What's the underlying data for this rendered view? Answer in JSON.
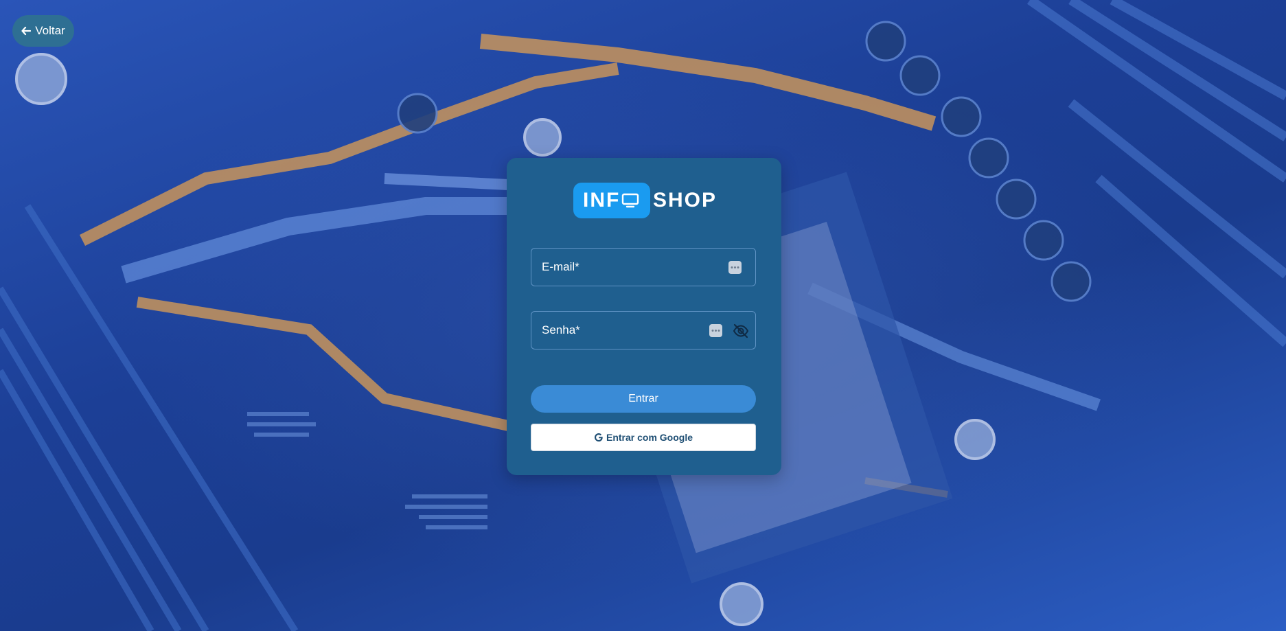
{
  "nav": {
    "back_label": "Voltar",
    "back_icon": "arrow-left-icon"
  },
  "logo": {
    "part1": "INF",
    "part2": "SHOP",
    "icon": "monitor-icon"
  },
  "form": {
    "email": {
      "placeholder": "E-mail*",
      "value": "",
      "icon": "password-manager-icon"
    },
    "password": {
      "placeholder": "Senha*",
      "value": "",
      "icon": "password-manager-icon",
      "toggle_icon": "eye-slash-icon"
    },
    "submit_label": "Entrar",
    "google_label": "Entrar com Google",
    "google_icon": "google-icon"
  },
  "colors": {
    "card": "#1f5f8f",
    "accent": "#3a8bd6",
    "logo_box": "#1a9bf0",
    "back_button": "#2e6f93"
  }
}
